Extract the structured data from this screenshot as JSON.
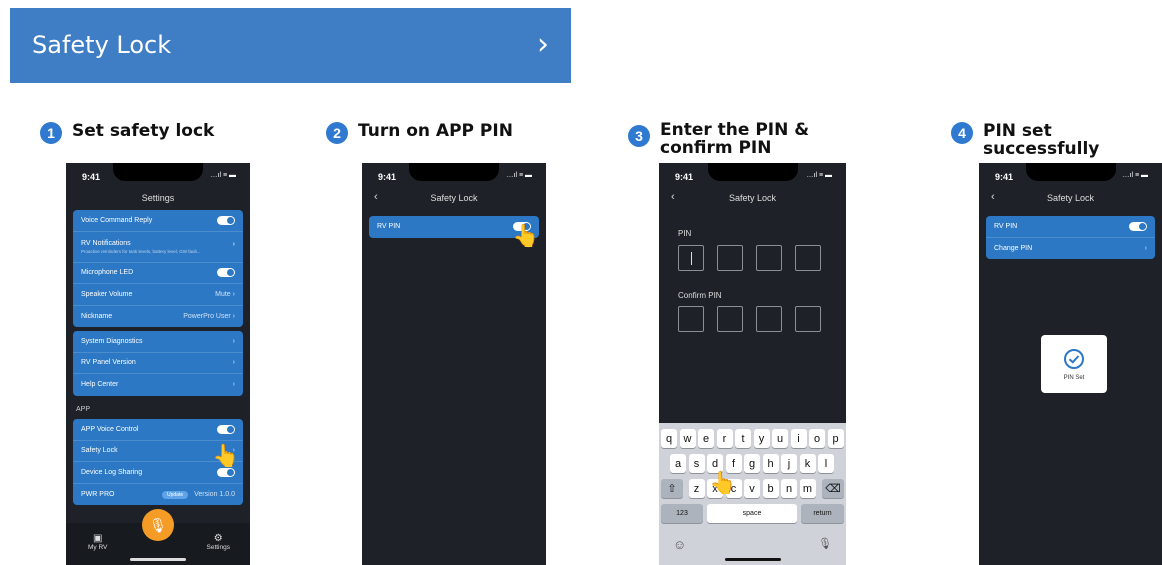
{
  "banner": {
    "title": "Safety Lock",
    "chevron": "›"
  },
  "steps": [
    {
      "num": "1",
      "label": "Set safety lock"
    },
    {
      "num": "2",
      "label": "Turn on APP PIN"
    },
    {
      "num": "3",
      "label": "Enter the PIN & confirm PIN"
    },
    {
      "num": "4",
      "label": "PIN set successfully"
    }
  ],
  "status": {
    "time": "9:41",
    "icons": "…ıl ≡ ▬"
  },
  "phone1": {
    "title": "Settings",
    "group1": [
      {
        "label": "Voice Command Reply",
        "toggle": "on"
      },
      {
        "label": "RV Notifications",
        "sub": "Proactive reminders for tank levels, battery level, GW fault..."
      },
      {
        "label": "Microphone LED",
        "toggle": "on"
      },
      {
        "label": "Speaker Volume",
        "value": "Mute"
      },
      {
        "label": "Nickname",
        "value": "PowerPro User"
      }
    ],
    "group2": [
      {
        "label": "System Diagnostics"
      },
      {
        "label": "RV Panel Version"
      },
      {
        "label": "Help Center"
      }
    ],
    "section_app": "APP",
    "group3": [
      {
        "label": "APP Voice Control",
        "toggle": "on"
      },
      {
        "label": "Safety Lock"
      },
      {
        "label": "Device Log Sharing"
      },
      {
        "label": "PWR PRO",
        "badge": "Update",
        "value": "Version 1.0.0"
      }
    ],
    "tabs": {
      "left": "My RV",
      "right": "Settings"
    }
  },
  "phone2": {
    "title": "Safety Lock",
    "row": "RV PIN"
  },
  "phone3": {
    "title": "Safety Lock",
    "pin_label": "PIN",
    "confirm_label": "Confirm PIN",
    "keys_row1": [
      "q",
      "w",
      "e",
      "r",
      "t",
      "y",
      "u",
      "i",
      "o",
      "p"
    ],
    "keys_row2": [
      "a",
      "s",
      "d",
      "f",
      "g",
      "h",
      "j",
      "k",
      "l"
    ],
    "keys_row3": [
      "z",
      "x",
      "c",
      "v",
      "b",
      "n",
      "m"
    ],
    "key_shift": "⇧",
    "key_delete": "⌫",
    "key_123": "123",
    "key_space": "space",
    "key_return": "return",
    "key_emoji": "☺",
    "key_mic": "🎙"
  },
  "phone4": {
    "title": "Safety Lock",
    "rows": [
      {
        "label": "RV PIN",
        "toggle": "on"
      },
      {
        "label": "Change PIN"
      }
    ],
    "card_label": "PIN Set"
  },
  "colors": {
    "banner": "#3f7ec5",
    "accent": "#2c78c4",
    "mic": "#f59c27",
    "dark": "#1e2228"
  }
}
